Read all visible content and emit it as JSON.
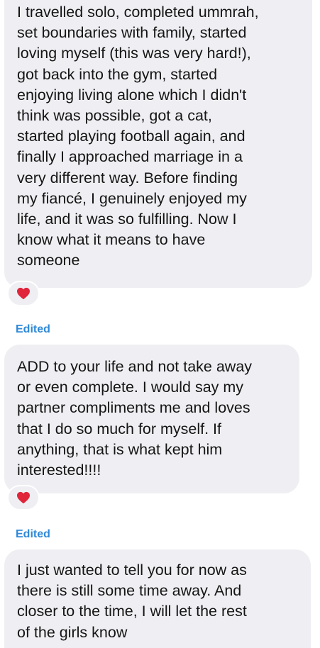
{
  "messages": [
    {
      "lines": [
        "I travelled solo, completed ummrah,",
        "set boundaries with family, started",
        "loving myself (this was very hard!),",
        "got back into the gym, started",
        "enjoying living alone which I didn't",
        "think was possible, got a cat,",
        "started playing football again, and",
        "finally I approached marriage in a",
        "very different way. Before finding",
        "my fiancé, I genuinely enjoyed my",
        "life, and it was so fulfilling. Now I",
        "know what it means to have",
        "someone"
      ],
      "reaction": "red-heart",
      "edited_label": "Edited"
    },
    {
      "lines": [
        "ADD to your life and not take away",
        "or even complete. I would say my",
        "partner compliments me and loves",
        "that I do so much for myself. If",
        "anything, that is what kept him",
        "interested!!!!"
      ],
      "reaction": "red-heart",
      "edited_label": "Edited"
    },
    {
      "lines": [
        "I just wanted to tell you for now as",
        "there is still some time away. And",
        "closer to the time, I will let the rest",
        "of the girls know"
      ]
    }
  ],
  "colors": {
    "bubble": "#efeff3",
    "text": "#151515",
    "edited": "#2f89d8",
    "heart": "#e0243a"
  }
}
